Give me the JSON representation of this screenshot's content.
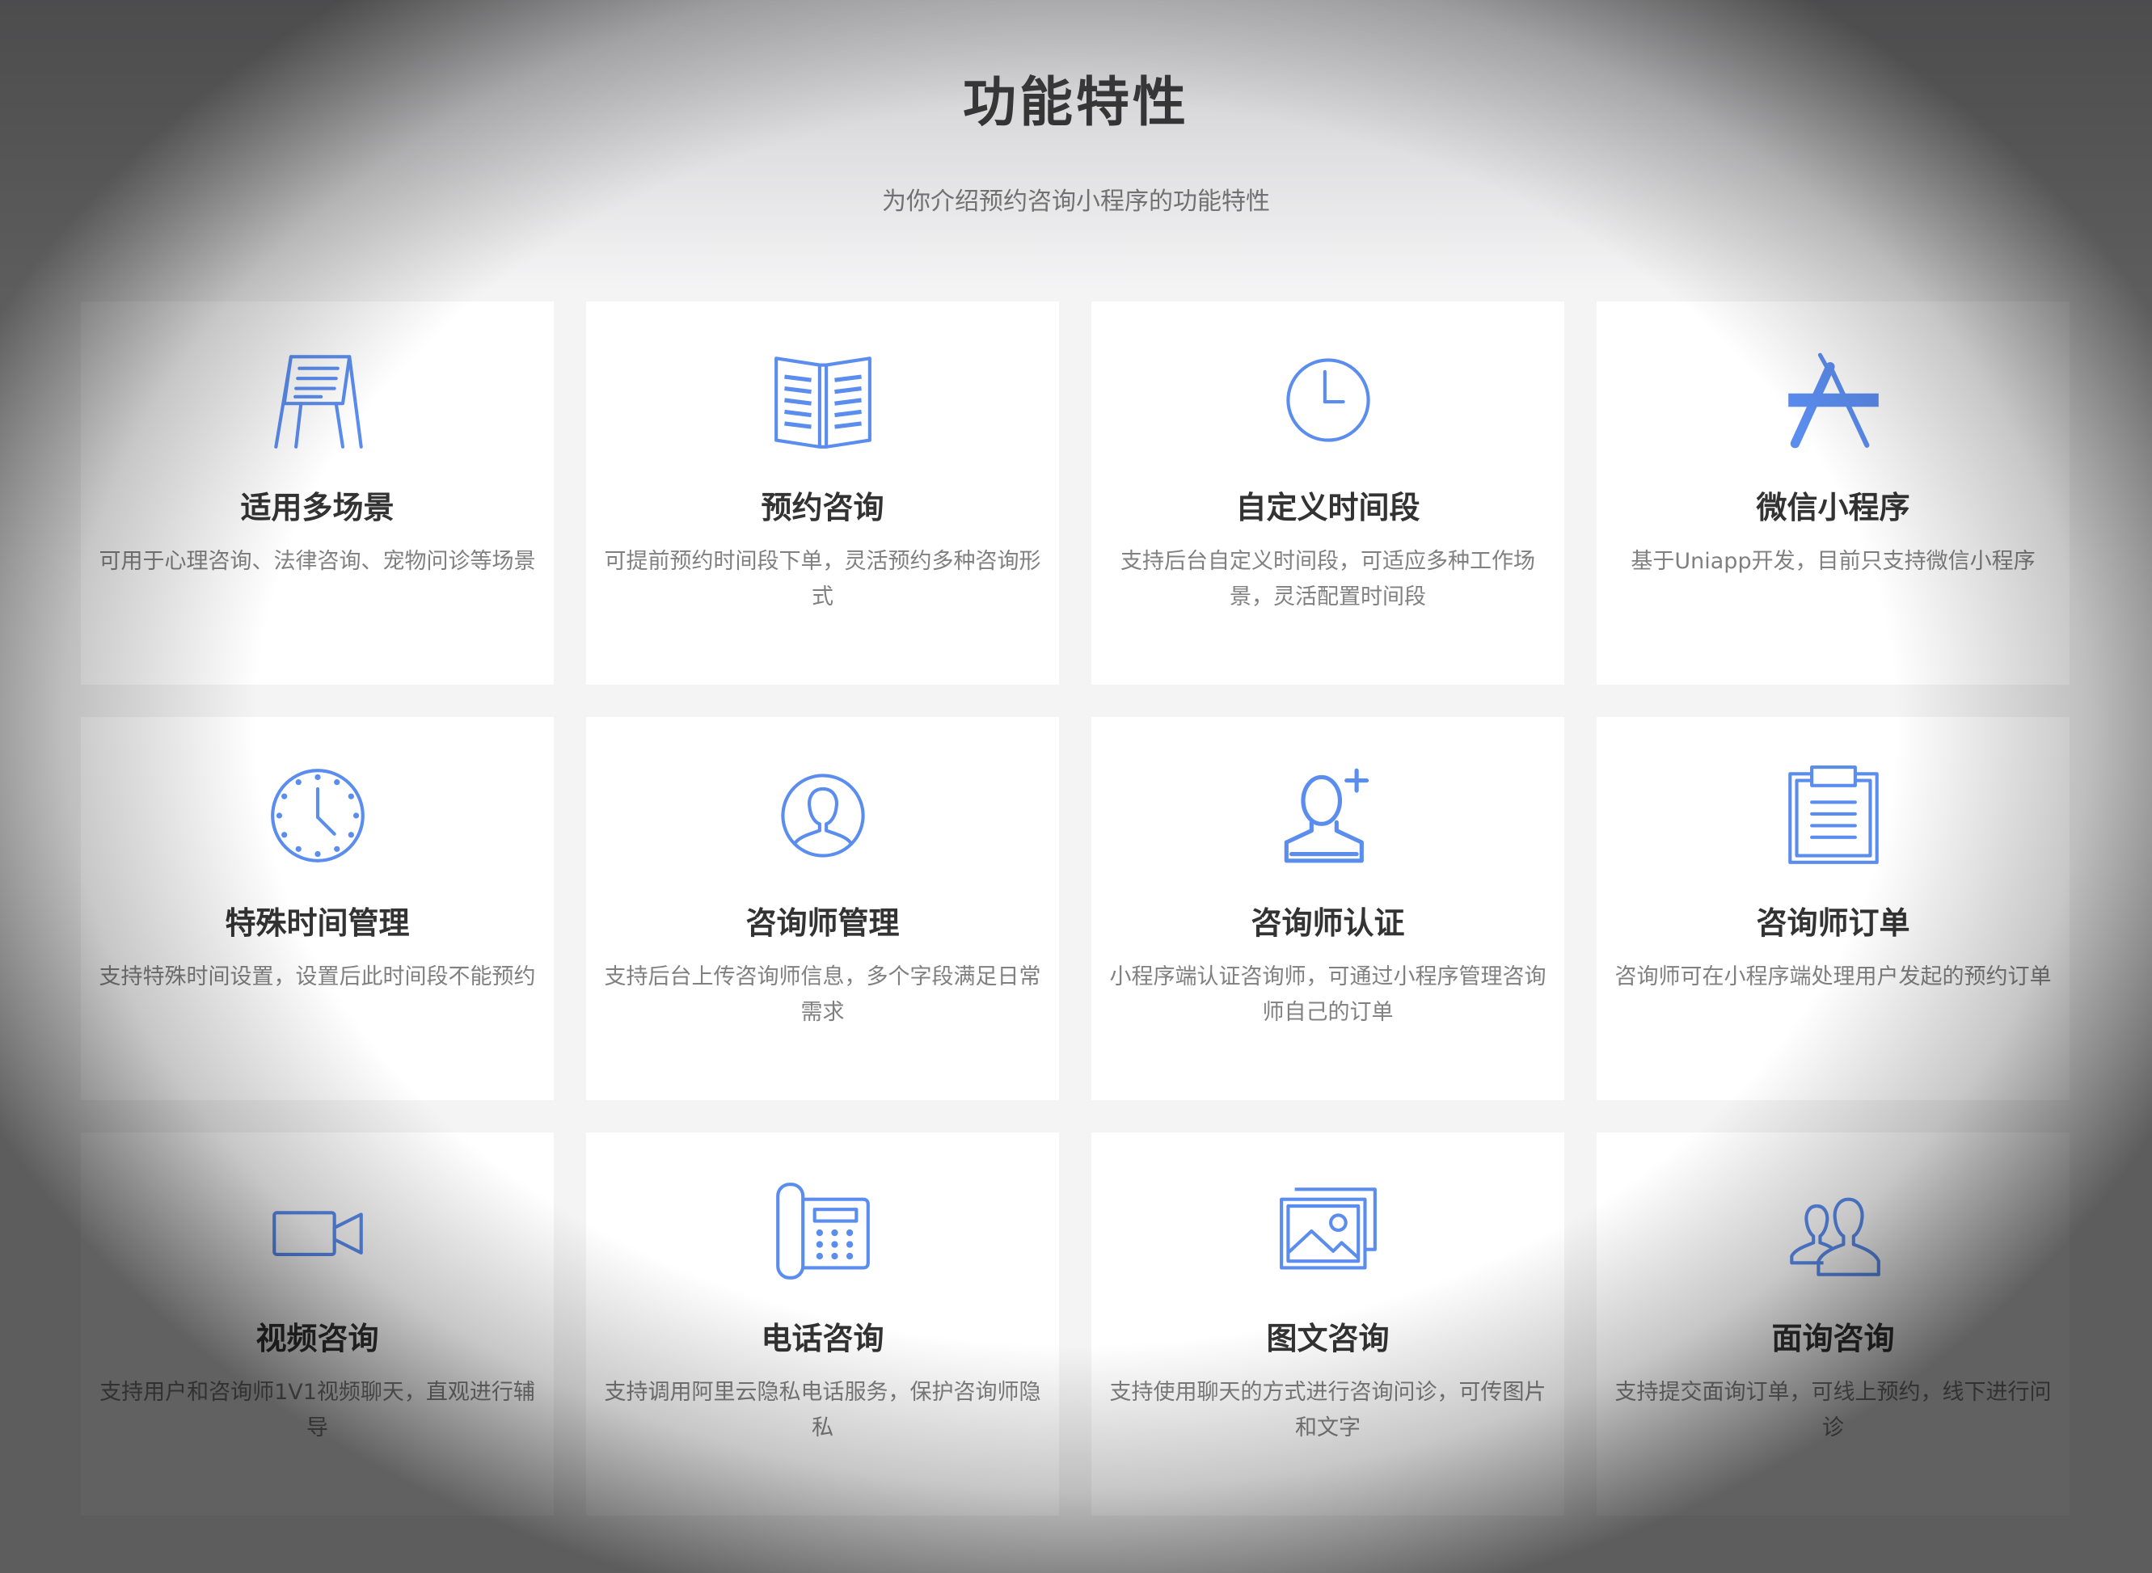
{
  "header": {
    "title": "功能特性",
    "subtitle": "为你介绍预约咨询小程序的功能特性"
  },
  "accent_color": "#5b8def",
  "features": [
    {
      "icon": "easel-icon",
      "title": "适用多场景",
      "desc": "可用于心理咨询、法律咨询、宠物问诊等场景"
    },
    {
      "icon": "book-icon",
      "title": "预约咨询",
      "desc": "可提前预约时间段下单，灵活预约多种咨询形式"
    },
    {
      "icon": "clock-icon",
      "title": "自定义时间段",
      "desc": "支持后台自定义时间段，可适应多种工作场景，灵活配置时间段"
    },
    {
      "icon": "app-store-icon",
      "title": "微信小程序",
      "desc": "基于Uniapp开发，目前只支持微信小程序"
    },
    {
      "icon": "wall-clock-icon",
      "title": "特殊时间管理",
      "desc": "支持特殊时间设置，设置后此时间段不能预约"
    },
    {
      "icon": "user-circle-icon",
      "title": "咨询师管理",
      "desc": "支持后台上传咨询师信息，多个字段满足日常需求"
    },
    {
      "icon": "add-user-icon",
      "title": "咨询师认证",
      "desc": "小程序端认证咨询师，可通过小程序管理咨询师自己的订单"
    },
    {
      "icon": "clipboard-icon",
      "title": "咨询师订单",
      "desc": "咨询师可在小程序端处理用户发起的预约订单"
    },
    {
      "icon": "video-camera-icon",
      "title": "视频咨询",
      "desc": "支持用户和咨询师1V1视频聊天，直观进行辅导"
    },
    {
      "icon": "telephone-icon",
      "title": "电话咨询",
      "desc": "支持调用阿里云隐私电话服务，保护咨询师隐私"
    },
    {
      "icon": "image-icon",
      "title": "图文咨询",
      "desc": "支持使用聊天的方式进行咨询问诊，可传图片和文字"
    },
    {
      "icon": "users-icon",
      "title": "面询咨询",
      "desc": "支持提交面询订单，可线上预约，线下进行问诊"
    }
  ]
}
